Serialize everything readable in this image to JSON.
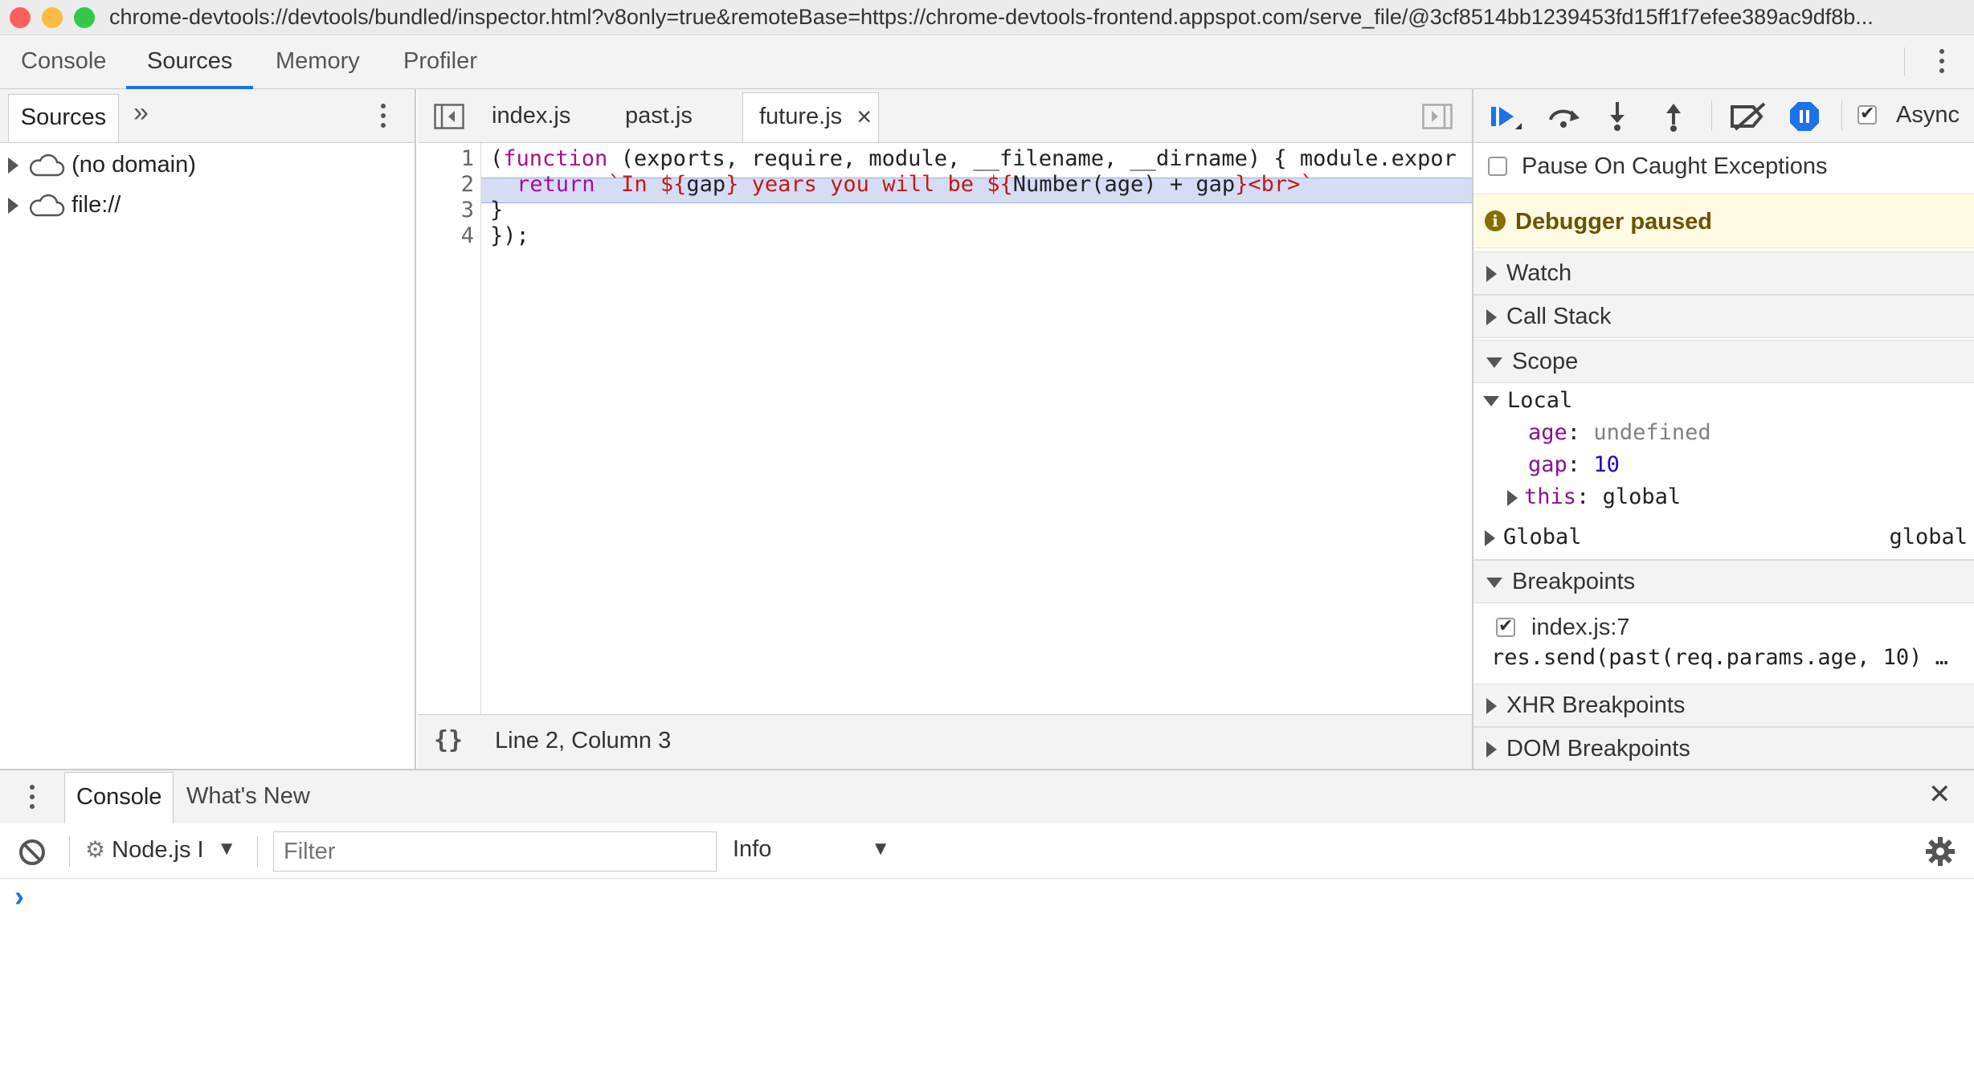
{
  "window": {
    "url": "chrome-devtools://devtools/bundled/inspector.html?v8only=true&remoteBase=https://chrome-devtools-frontend.appspot.com/serve_file/@3cf8514bb1239453fd15ff1f7efee389ac9df8b..."
  },
  "main_tabs": [
    "Console",
    "Sources",
    "Memory",
    "Profiler"
  ],
  "navigator": {
    "tab_label": "Sources",
    "more_glyph": "»",
    "items": [
      "(no domain)",
      "file://"
    ]
  },
  "editor": {
    "tabs": [
      "index.js",
      "past.js",
      "future.js"
    ],
    "close_glyph": "×",
    "line_numbers": [
      "1",
      "2",
      "3",
      "4"
    ],
    "line1_prefix": "(",
    "line1_kw": "function",
    "line1_rest": " (exports, require, module, __filename, __dirname) { module.expor",
    "line2_kw": "return",
    "line2_str1": " `In ${",
    "line2_var1": "gap",
    "line2_str2": "} years you will be ${",
    "line2_expr": "Number(age) + gap",
    "line2_str3": "}<br>`",
    "line3": "}",
    "line4": "});",
    "status_glyph": "{}",
    "status_text": "Line 2, Column 3"
  },
  "debugger": {
    "async_label": "Async",
    "pause_caught_label": "Pause On Caught Exceptions",
    "paused_label": "Debugger paused",
    "info_glyph": "i",
    "sections": {
      "watch": "Watch",
      "call_stack": "Call Stack",
      "scope": "Scope",
      "breakpoints": "Breakpoints",
      "xhr": "XHR Breakpoints",
      "dom": "DOM Breakpoints"
    },
    "scope": {
      "local_label": "Local",
      "age_key": "age",
      "age_value": "undefined",
      "gap_key": "gap",
      "gap_value": "10",
      "this_key": "this",
      "this_value": "global",
      "global_label": "Global",
      "global_value": "global",
      "sep": ":"
    },
    "breakpoint": {
      "location": "index.js:7",
      "code": "res.send(past(req.params.age, 10) …"
    }
  },
  "drawer": {
    "tabs": [
      "Console",
      "What's New"
    ],
    "close_glyph": "✕",
    "context": "Node.js I",
    "filter_placeholder": "Filter",
    "level": "Info",
    "prompt": "›"
  },
  "colors": {
    "accent": "#1a73e8",
    "paused_bg": "#fffbe5",
    "highlight": "#d5ddf5"
  }
}
